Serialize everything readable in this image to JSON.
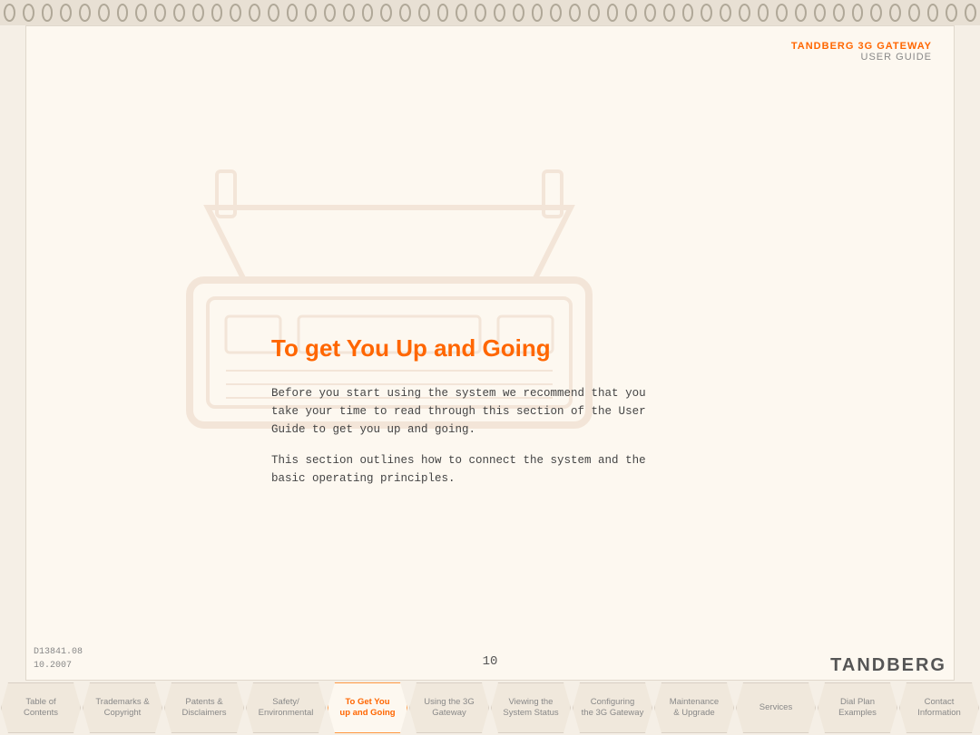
{
  "header": {
    "brand_prefix": "TANDBERG",
    "brand_product": "3G GATEWAY",
    "guide_label": "USER GUIDE"
  },
  "page": {
    "title": "To get You Up and Going",
    "paragraph1": "Before you start using the system we recommend that you take your time to read through this section of the User Guide to get you up and going.",
    "paragraph2": "This section outlines how to connect the system and the basic operating principles.",
    "page_number": "10",
    "doc_id": "D13841.08",
    "doc_date": "10.2007",
    "tandberg_logo": "TANDBERG"
  },
  "nav_tabs": [
    {
      "id": "table-of-contents",
      "label": "Table of\nContents",
      "active": false
    },
    {
      "id": "trademarks-copyright",
      "label": "Trademarks &\nCopyright",
      "active": false
    },
    {
      "id": "patents-disclaimers",
      "label": "Patents &\nDisclaimers",
      "active": false
    },
    {
      "id": "safety-environmental",
      "label": "Safety/\nEnvironmental",
      "active": false
    },
    {
      "id": "get-you-up-going",
      "label": "To Get You\nup and Going",
      "active": true
    },
    {
      "id": "using-3g-gateway",
      "label": "Using the 3G\nGateway",
      "active": false
    },
    {
      "id": "viewing-system-status",
      "label": "Viewing the\nSystem Status",
      "active": false
    },
    {
      "id": "configuring-3g-gateway",
      "label": "Configuring\nthe 3G Gateway",
      "active": false
    },
    {
      "id": "maintenance-upgrade",
      "label": "Maintenance\n& Upgrade",
      "active": false
    },
    {
      "id": "services",
      "label": "Services",
      "active": false
    },
    {
      "id": "dial-plan-examples",
      "label": "Dial Plan\nExamples",
      "active": false
    },
    {
      "id": "contact-information",
      "label": "Contact\nInformation",
      "active": false
    }
  ],
  "spiral": {
    "count": 52
  }
}
